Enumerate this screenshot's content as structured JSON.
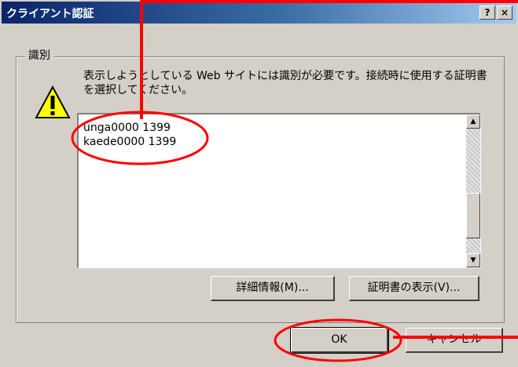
{
  "window": {
    "title": "クライアント認証",
    "help_button": "?",
    "close_button": "×"
  },
  "group": {
    "label": "識別"
  },
  "message": "表示しようとしている Web サイトには識別が必要です。接続時に使用する証明書を選択してください。",
  "certificates": [
    "unga0000 1399",
    "kaede0000 1399"
  ],
  "buttons": {
    "details": "詳細情報(M)...",
    "view_cert": "証明書の表示(V)...",
    "ok": "OK",
    "cancel": "キャンセル"
  },
  "colors": {
    "annotation": "#ff0000",
    "title_start": "#0a246a",
    "title_end": "#a6caf0"
  },
  "icons": {
    "warning": "warning-icon"
  }
}
